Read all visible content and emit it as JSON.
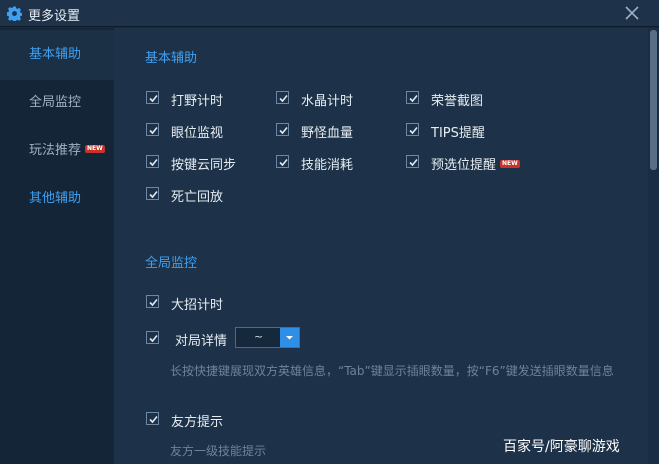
{
  "window": {
    "title": "更多设置",
    "icon": "gear-icon",
    "close_icon": "close-icon"
  },
  "sidebar": {
    "items": [
      {
        "label": "基本辅助",
        "active": true
      },
      {
        "label": "全局监控"
      },
      {
        "label": "玩法推荐",
        "badge": "NEW"
      },
      {
        "label": "其他辅助"
      }
    ]
  },
  "basic": {
    "title": "基本辅助",
    "options": [
      {
        "label": "打野计时",
        "checked": true
      },
      {
        "label": "水晶计时",
        "checked": true
      },
      {
        "label": "荣誉截图",
        "checked": true
      },
      {
        "label": "眼位监视",
        "checked": true
      },
      {
        "label": "野怪血量",
        "checked": true
      },
      {
        "label": "TIPS提醒",
        "checked": true
      },
      {
        "label": "按键云同步",
        "checked": true
      },
      {
        "label": "技能消耗",
        "checked": true
      },
      {
        "label": "预选位提醒",
        "checked": true,
        "badge": "NEW"
      },
      {
        "label": "死亡回放",
        "checked": true
      }
    ]
  },
  "global": {
    "title": "全局监控",
    "ult_timer": {
      "label": "大招计时",
      "checked": true
    },
    "match_detail": {
      "label": "对局详情",
      "checked": true,
      "select_value": "~"
    },
    "match_hint": "长按快捷键展现双方英雄信息，“Tab”键显示插眼数量，按“F6”键发送插眼数量信息",
    "ally_tip": {
      "label": "友方提示",
      "checked": true
    },
    "ally_hint": "友方一级技能提示"
  },
  "watermark": "百家号/阿豪聊游戏",
  "colors": {
    "accent": "#3fa0f2",
    "background": "#1d3248",
    "badge": "#c8342c"
  }
}
